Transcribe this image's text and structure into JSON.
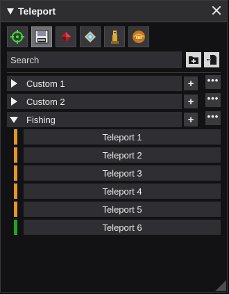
{
  "window": {
    "title": "Teleport"
  },
  "toolbar": {
    "tools": [
      {
        "name": "target-icon",
        "active": false
      },
      {
        "name": "save-icon",
        "active": true
      },
      {
        "name": "red-gem-icon",
        "active": false
      },
      {
        "name": "blue-diamond-icon",
        "active": false
      },
      {
        "name": "statue-icon",
        "active": false
      },
      {
        "name": "bread-icon",
        "active": false
      }
    ]
  },
  "search": {
    "placeholder": "Search",
    "value": ""
  },
  "groups": [
    {
      "label": "Custom 1",
      "expanded": false
    },
    {
      "label": "Custom 2",
      "expanded": false
    },
    {
      "label": "Fishing",
      "expanded": true
    }
  ],
  "group_actions": {
    "add_label": "+",
    "more_label": "•••"
  },
  "fishing_items": [
    {
      "label": "Teleport 1",
      "marker_color": "#e2962a"
    },
    {
      "label": "Teleport 2",
      "marker_color": "#e2962a"
    },
    {
      "label": "Teleport 3",
      "marker_color": "#e2962a"
    },
    {
      "label": "Teleport 4",
      "marker_color": "#e2962a"
    },
    {
      "label": "Teleport 5",
      "marker_color": "#e2962a"
    },
    {
      "label": "Teleport 6",
      "marker_color": "#1fa51f"
    }
  ]
}
